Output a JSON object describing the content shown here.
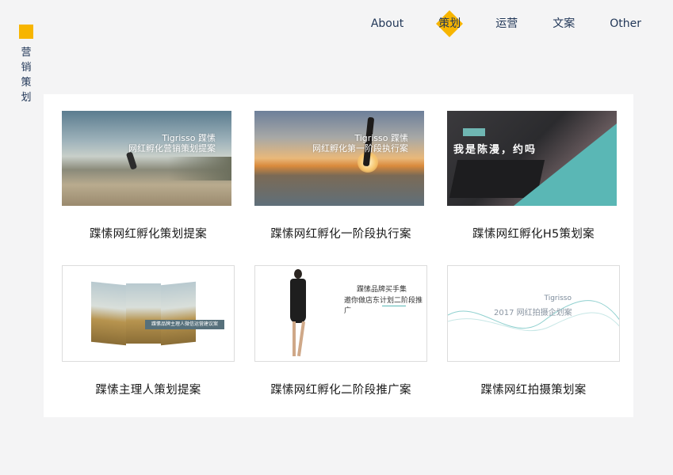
{
  "brand": {
    "title": "营销策划",
    "accent": "#f7b500"
  },
  "nav": {
    "items": [
      {
        "label": "About",
        "active": false
      },
      {
        "label": "策划",
        "active": true
      },
      {
        "label": "运营",
        "active": false
      },
      {
        "label": "文案",
        "active": false
      },
      {
        "label": "Other",
        "active": false
      }
    ]
  },
  "cards": [
    {
      "caption": "蹀愫网红孵化策划提案",
      "overlay": "Tigrisso 蹀愫\n网红孵化营销策划提案"
    },
    {
      "caption": "蹀愫网红孵化一阶段执行案",
      "overlay": "Tigrisso 蹀愫\n网红孵化第一阶段执行案"
    },
    {
      "caption": "蹀愫网红孵化H5策划案",
      "overlay": "我是陈漫，约吗"
    },
    {
      "caption": "蹀愫主理人策划提案",
      "overlay": "蹀愫品牌主理人微信运营建议案"
    },
    {
      "caption": "蹀愫网红孵化二阶段推广案",
      "overlay1": "蹀愫品牌买手集",
      "overlay2": "邀你做店东计划二阶段推广"
    },
    {
      "caption": "蹀愫网红拍摄策划案",
      "overlay_en": "Tigrisso",
      "overlay_cn": "2017 网红拍摄企划案"
    }
  ]
}
